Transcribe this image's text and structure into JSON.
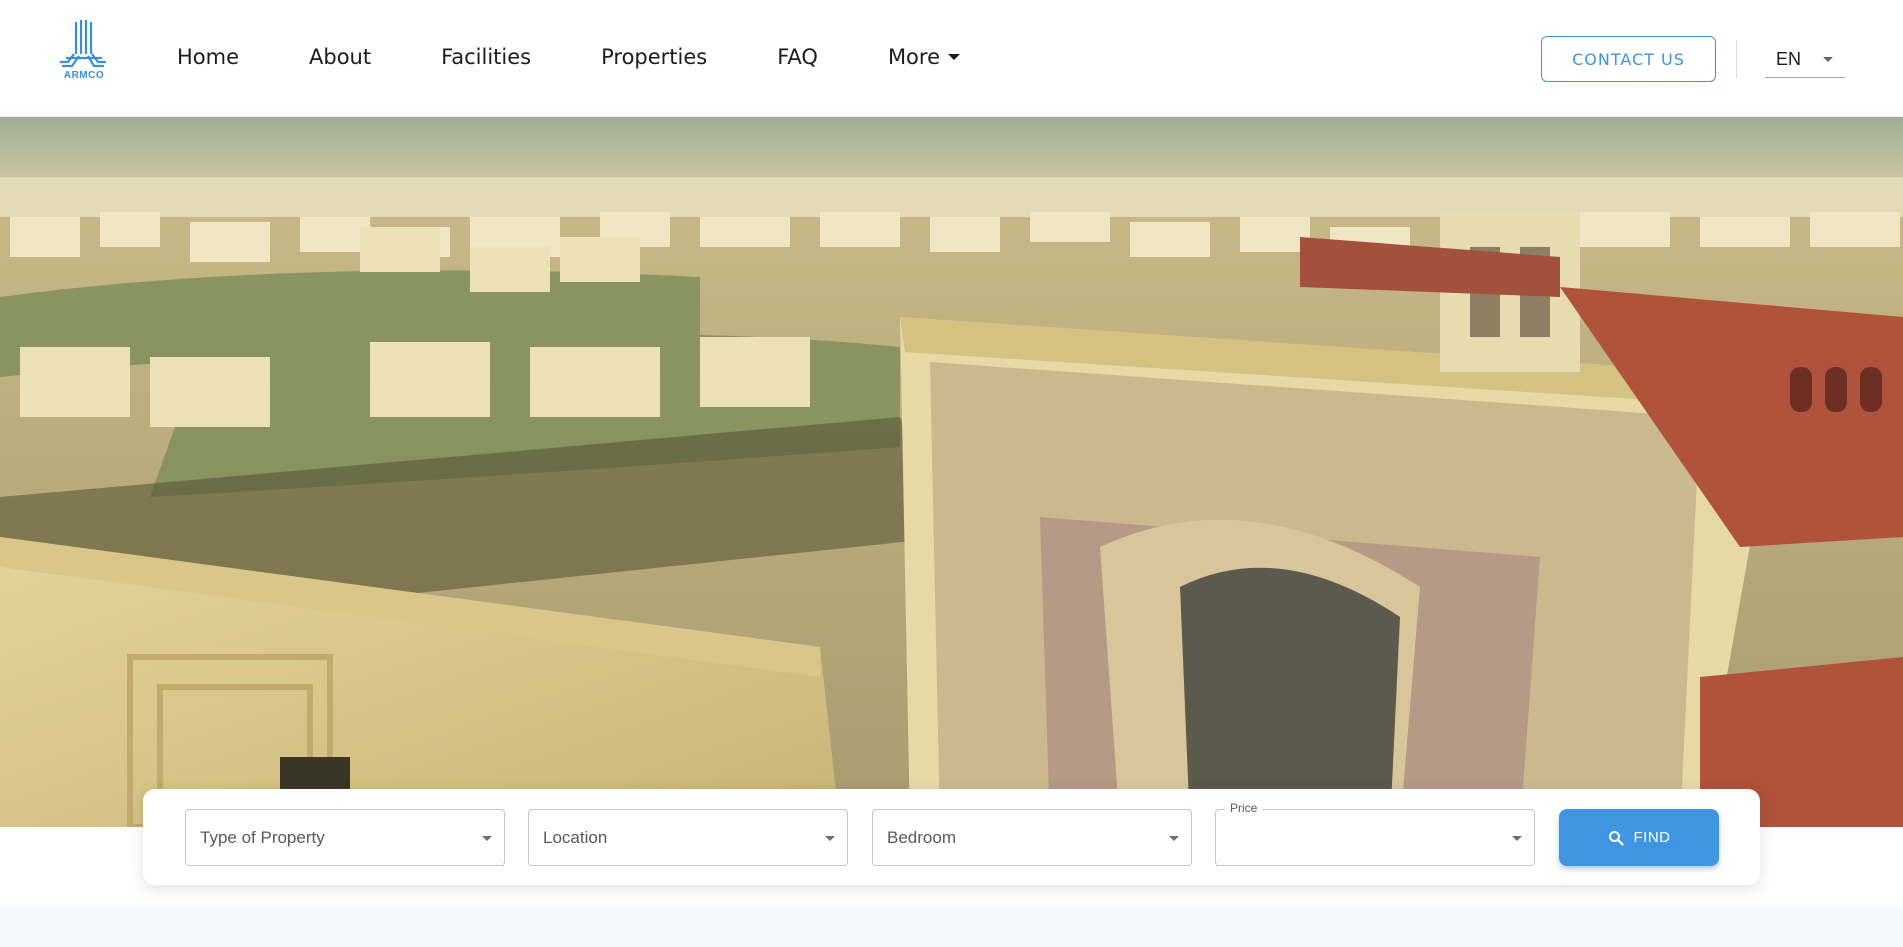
{
  "brand": {
    "logo_text": "ARMCO",
    "accent": "#3f95d9"
  },
  "nav": {
    "items": [
      {
        "label": "Home"
      },
      {
        "label": "About"
      },
      {
        "label": "Facilities"
      },
      {
        "label": "Properties"
      },
      {
        "label": "FAQ"
      }
    ],
    "more_label": "More"
  },
  "header": {
    "contact_label": "CONTACT US",
    "language": "EN"
  },
  "hero": {
    "image": "aerial-view-residential-compound"
  },
  "search": {
    "type_placeholder": "Type of Property",
    "location_placeholder": "Location",
    "bedroom_placeholder": "Bedroom",
    "price_label": "Price",
    "price_value": "",
    "find_label": "FIND",
    "find_color": "#3f95e0"
  }
}
